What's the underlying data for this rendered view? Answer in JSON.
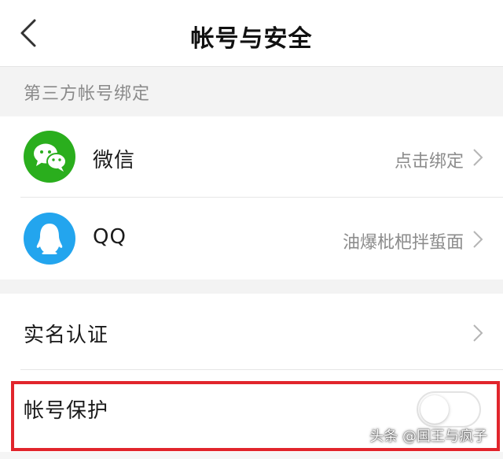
{
  "header": {
    "title": "帐号与安全"
  },
  "third_party_section": {
    "header": "第三方帐号绑定",
    "items": [
      {
        "name": "微信",
        "value": "点击绑定",
        "icon": "wechat-icon",
        "color": "#2aae1d"
      },
      {
        "name": "QQ",
        "value": "油爆枇杷拌蜇面",
        "icon": "qq-icon",
        "color": "#23a5ee"
      }
    ]
  },
  "security_section": {
    "items": [
      {
        "name": "实名认证"
      },
      {
        "name": "帐号保护",
        "toggle_on": false
      }
    ]
  },
  "highlight_color": "#e1252c",
  "watermark": "头条 @国王与疯子"
}
